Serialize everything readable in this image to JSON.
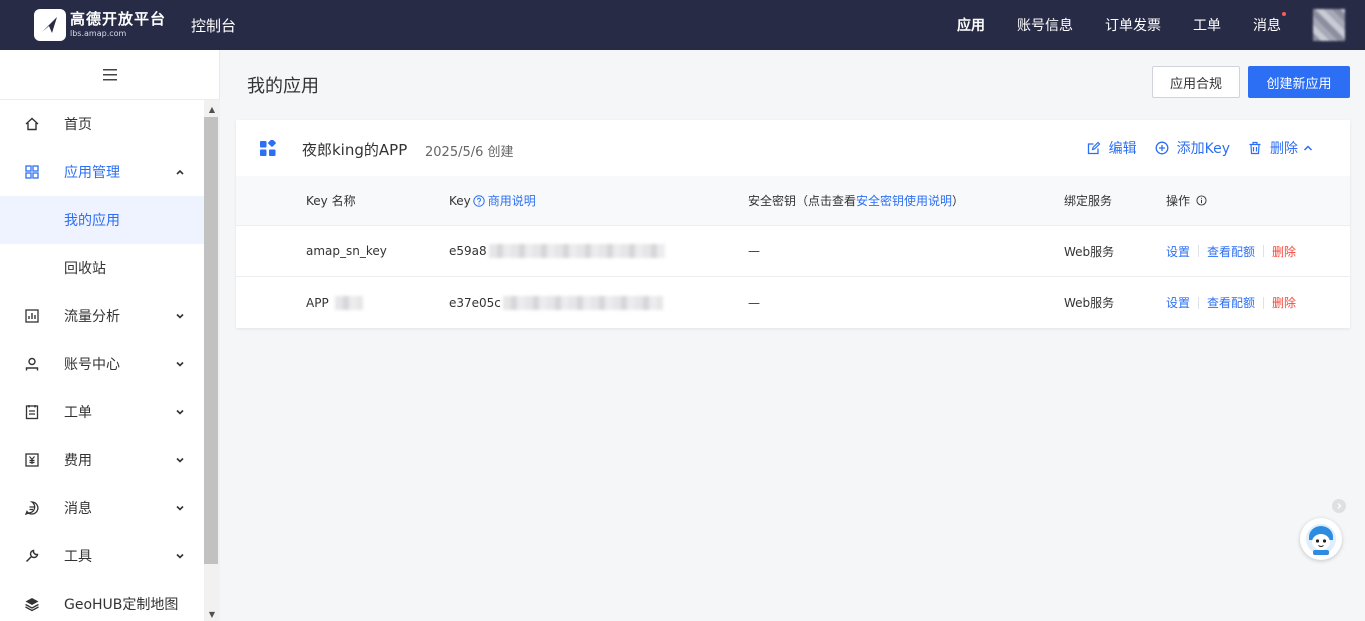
{
  "topbar": {
    "logo_title": "高德开放平台",
    "logo_sub": "lbs.amap.com",
    "console": "控制台",
    "nav": [
      "应用",
      "账号信息",
      "订单发票",
      "工单",
      "消息"
    ]
  },
  "sidebar": {
    "toggle_icon": "menu-icon",
    "items": [
      {
        "label": "首页",
        "icon": "home-icon"
      },
      {
        "label": "应用管理",
        "icon": "grid-icon"
      },
      {
        "label": "我的应用"
      },
      {
        "label": "回收站"
      },
      {
        "label": "流量分析",
        "icon": "chart-icon"
      },
      {
        "label": "账号中心",
        "icon": "user-icon"
      },
      {
        "label": "工单",
        "icon": "ticket-icon"
      },
      {
        "label": "费用",
        "icon": "fee-icon"
      },
      {
        "label": "消息",
        "icon": "message-icon"
      },
      {
        "label": "工具",
        "icon": "wrench-icon"
      },
      {
        "label": "GeoHUB定制地图",
        "icon": "layers-icon"
      }
    ]
  },
  "main": {
    "title": "我的应用",
    "btn_compliance": "应用合规",
    "btn_create": "创建新应用",
    "app": {
      "name": "夜郎king的APP",
      "date": "2025/5/6 创建",
      "edit": "编辑",
      "add_key": "添加Key",
      "delete": "删除"
    },
    "table": {
      "headers": {
        "key_name": "Key 名称",
        "key": "Key",
        "key_help": "商用说明",
        "secret_prefix": "安全密钥（点击查看",
        "secret_link": "安全密钥使用说明",
        "secret_suffix": "）",
        "service": "绑定服务",
        "ops": "操作"
      },
      "rows": [
        {
          "name": "amap_sn_key",
          "key": "e59a8",
          "secret": "—",
          "service": "Web服务",
          "op1": "设置",
          "op2": "查看配额",
          "op3": "删除"
        },
        {
          "name": "APP",
          "key": "e37e05c",
          "secret": "—",
          "service": "Web服务",
          "op1": "设置",
          "op2": "查看配额",
          "op3": "删除"
        }
      ]
    }
  },
  "colors": {
    "topbar": "#272b46",
    "primary": "#2d6ff4",
    "danger": "#f5483b"
  }
}
